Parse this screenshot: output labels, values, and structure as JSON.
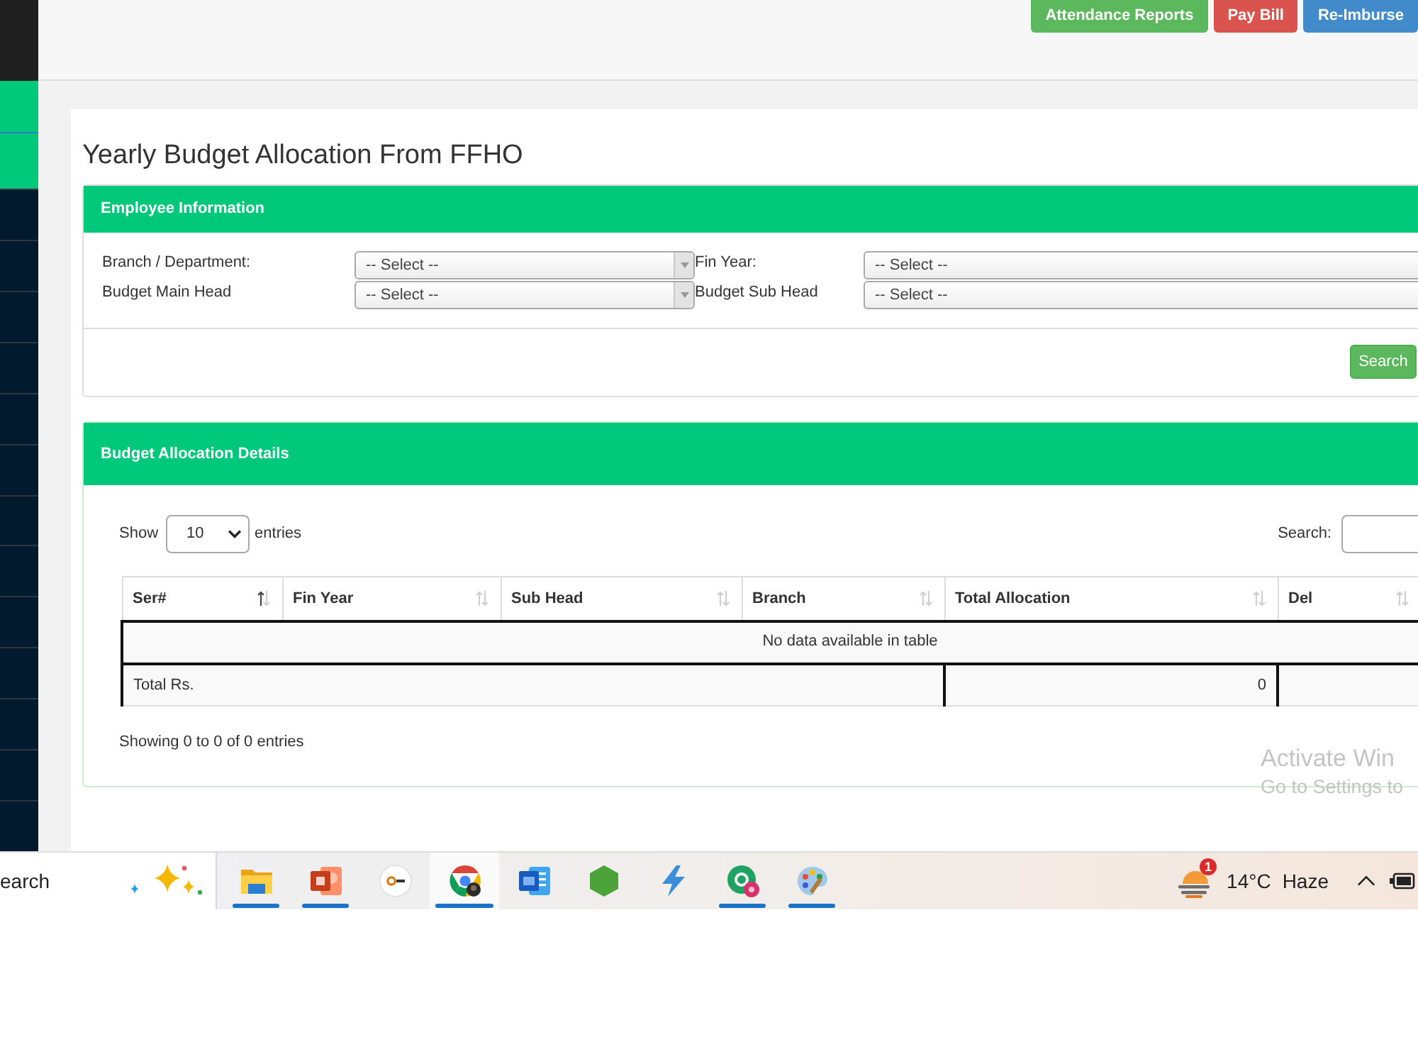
{
  "top_bar": {
    "buttons": [
      {
        "label": "Attendance Reports",
        "kind": "success"
      },
      {
        "label": "Pay Bill",
        "kind": "danger"
      },
      {
        "label": "Re-Imburse",
        "kind": "primary"
      }
    ]
  },
  "sidebar": {
    "items": [
      {
        "active": true
      },
      {
        "active": true
      },
      {
        "active": false
      },
      {
        "active": false
      },
      {
        "active": false
      },
      {
        "active": false
      },
      {
        "active": false
      },
      {
        "active": false
      },
      {
        "active": false
      },
      {
        "active": false
      },
      {
        "active": false
      },
      {
        "active": false
      },
      {
        "active": false
      },
      {
        "active": false
      },
      {
        "active": false
      }
    ]
  },
  "page_title": "Yearly Budget Allocation From FFHO",
  "employee_panel": {
    "title": "Employee Information",
    "fields": [
      {
        "label": "Branch / Department:",
        "value": "-- Select --"
      },
      {
        "label": "Fin Year:",
        "value": "-- Select --"
      },
      {
        "label": "Budget Main Head",
        "value": "-- Select --"
      },
      {
        "label": "Budget Sub Head",
        "value": "-- Select --"
      }
    ],
    "search_button": "Search"
  },
  "allocation_panel": {
    "title": "Budget Allocation Details",
    "length_menu": {
      "before": "Show",
      "value": "10",
      "after": "entries"
    },
    "search_label": "Search:",
    "table": {
      "columns": [
        {
          "label": "Ser#",
          "sorted": true
        },
        {
          "label": "Fin Year",
          "sorted": false
        },
        {
          "label": "Sub Head",
          "sorted": false
        },
        {
          "label": "Branch",
          "sorted": false
        },
        {
          "label": "Total Allocation",
          "sorted": false
        },
        {
          "label": "Del",
          "sorted": false
        }
      ],
      "empty_message": "No data available in table",
      "footer": {
        "label": "Total Rs.",
        "total": "0"
      }
    },
    "info": "Showing 0 to 0 of 0 entries"
  },
  "activation_notice": {
    "title": "Activate Win",
    "subtitle": "Go to Settings to"
  },
  "taskbar": {
    "search": {
      "placeholder": "earch"
    },
    "apps": [
      {
        "kind": "folder",
        "running": true,
        "selected": false
      },
      {
        "kind": "slides",
        "running": true,
        "selected": false
      },
      {
        "kind": "key",
        "running": false,
        "selected": false
      },
      {
        "kind": "browser",
        "running": true,
        "selected": true
      },
      {
        "kind": "document",
        "running": false,
        "selected": false
      },
      {
        "kind": "hexagon",
        "running": false,
        "selected": false
      },
      {
        "kind": "bolt",
        "running": false,
        "selected": false
      },
      {
        "kind": "chat",
        "running": true,
        "selected": false
      },
      {
        "kind": "palette",
        "running": true,
        "selected": false
      }
    ],
    "weather": {
      "badge": "1",
      "temperature": "14°C",
      "condition": "Haze"
    }
  }
}
